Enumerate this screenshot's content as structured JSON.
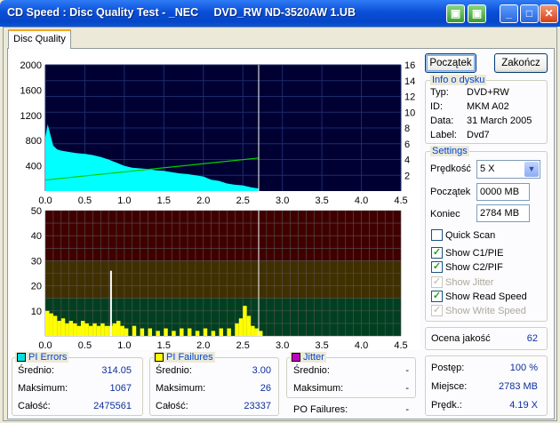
{
  "window": {
    "title": "CD Speed : Disc Quality Test - _NEC     DVD_RW ND-3520AW 1.UB",
    "buttons": [
      "▣",
      "▣",
      "_",
      "□",
      "✕"
    ]
  },
  "tab": {
    "label": "Disc Quality"
  },
  "buttons": {
    "start": "Początek",
    "end": "Zakończ"
  },
  "disc_info": {
    "legend": "Info o dysku",
    "rows": [
      {
        "label": "Typ:",
        "value": "DVD+RW"
      },
      {
        "label": "ID:",
        "value": "MKM A02"
      },
      {
        "label": "Data:",
        "value": "31 March 2005"
      },
      {
        "label": "Label:",
        "value": "Dvd7"
      }
    ]
  },
  "settings": {
    "legend": "Settings",
    "speed_label": "Prędkość",
    "speed_value": "5 X",
    "start_label": "Początek",
    "start_value": "0000 MB",
    "end_label": "Koniec",
    "end_value": "2784 MB",
    "checkboxes": [
      {
        "label": "Quick Scan",
        "checked": false,
        "enabled": true
      },
      {
        "label": "Show C1/PIE",
        "checked": true,
        "enabled": true
      },
      {
        "label": "Show C2/PIF",
        "checked": true,
        "enabled": true
      },
      {
        "label": "Show Jitter",
        "checked": true,
        "enabled": false
      },
      {
        "label": "Show Read Speed",
        "checked": true,
        "enabled": true
      },
      {
        "label": "Show Write Speed",
        "checked": true,
        "enabled": false
      }
    ]
  },
  "quality": {
    "label": "Ocena jakość",
    "value": "62"
  },
  "progress": {
    "rows": [
      {
        "label": "Postęp:",
        "value": "100 %"
      },
      {
        "label": "Miejsce:",
        "value": "2783 MB"
      },
      {
        "label": "Prędk.:",
        "value": "4.19 X"
      }
    ]
  },
  "stats": {
    "pi_errors": {
      "title": "PI Errors",
      "color": "#00e0e0",
      "avg_label": "Średnio:",
      "avg": "314.05",
      "max_label": "Maksimum:",
      "max": "1067",
      "total_label": "Całość:",
      "total": "2475561"
    },
    "pi_failures": {
      "title": "PI Failures",
      "color": "#ffff00",
      "avg_label": "Średnio:",
      "avg": "3.00",
      "max_label": "Maksimum:",
      "max": "26",
      "total_label": "Całość:",
      "total": "23337"
    },
    "jitter": {
      "title": "Jitter",
      "color": "#c000c0",
      "avg_label": "Średnio:",
      "avg": "-",
      "max_label": "Maksimum:",
      "max": "-",
      "po_label": "PO Failures:",
      "po": "-"
    }
  },
  "chart_data": [
    {
      "type": "area",
      "name": "PI Errors / Read Speed",
      "x_ticks": [
        "0.0",
        "0.5",
        "1.0",
        "1.5",
        "2.0",
        "2.5",
        "3.0",
        "3.5",
        "4.0",
        "4.5"
      ],
      "y_ticks_left": [
        "2000",
        "1600",
        "1200",
        "800",
        "400"
      ],
      "y_ticks_right": [
        "16",
        "14",
        "12",
        "10",
        "8",
        "6",
        "4",
        "2"
      ],
      "xlim": [
        0,
        4.5
      ],
      "ylim_left": [
        0,
        2000
      ],
      "ylim_right": [
        0,
        16
      ],
      "pi_errors": {
        "x": [
          0,
          0.03,
          0.05,
          0.1,
          0.15,
          0.2,
          0.3,
          0.4,
          0.5,
          0.6,
          0.7,
          0.8,
          0.9,
          1.0,
          1.1,
          1.2,
          1.3,
          1.4,
          1.5,
          1.6,
          1.7,
          1.8,
          1.9,
          2.0,
          2.1,
          2.2,
          2.3,
          2.4,
          2.5,
          2.6,
          2.7
        ],
        "y": [
          850,
          1060,
          960,
          720,
          660,
          640,
          620,
          600,
          590,
          570,
          540,
          500,
          450,
          400,
          370,
          360,
          350,
          330,
          320,
          300,
          280,
          270,
          250,
          230,
          180,
          160,
          120,
          100,
          90,
          60,
          40
        ]
      },
      "read_speed": {
        "x": [
          0,
          2.7
        ],
        "y": [
          1.4,
          4.19
        ]
      },
      "end_marker_x": 2.7
    },
    {
      "type": "bar",
      "name": "PI Failures",
      "x_ticks": [
        "0.0",
        "0.5",
        "1.0",
        "1.5",
        "2.0",
        "2.5",
        "3.0",
        "3.5",
        "4.0",
        "4.5"
      ],
      "y_ticks": [
        "50",
        "40",
        "30",
        "20",
        "10"
      ],
      "xlim": [
        0,
        4.5
      ],
      "ylim": [
        0,
        50
      ],
      "x": [
        0,
        0.05,
        0.1,
        0.15,
        0.2,
        0.25,
        0.3,
        0.35,
        0.4,
        0.45,
        0.5,
        0.55,
        0.6,
        0.65,
        0.7,
        0.75,
        0.8,
        0.82,
        0.85,
        0.9,
        0.95,
        1.0,
        1.1,
        1.2,
        1.3,
        1.4,
        1.5,
        1.6,
        1.7,
        1.8,
        1.9,
        2.0,
        2.1,
        2.2,
        2.3,
        2.4,
        2.45,
        2.5,
        2.55,
        2.6,
        2.65,
        2.7
      ],
      "y": [
        10,
        9,
        8,
        6,
        7,
        5,
        6,
        5,
        4,
        6,
        5,
        4,
        5,
        4,
        5,
        4,
        4,
        26,
        5,
        6,
        4,
        3,
        4,
        3,
        3,
        2,
        3,
        2,
        3,
        3,
        2,
        3,
        2,
        3,
        3,
        5,
        7,
        12,
        8,
        4,
        3,
        2
      ],
      "bands": [
        {
          "from": 0,
          "to": 15,
          "color": "#004020"
        },
        {
          "from": 15,
          "to": 30,
          "color": "#403000"
        },
        {
          "from": 30,
          "to": 50,
          "color": "#400000"
        }
      ],
      "end_marker_x": 2.7
    }
  ]
}
